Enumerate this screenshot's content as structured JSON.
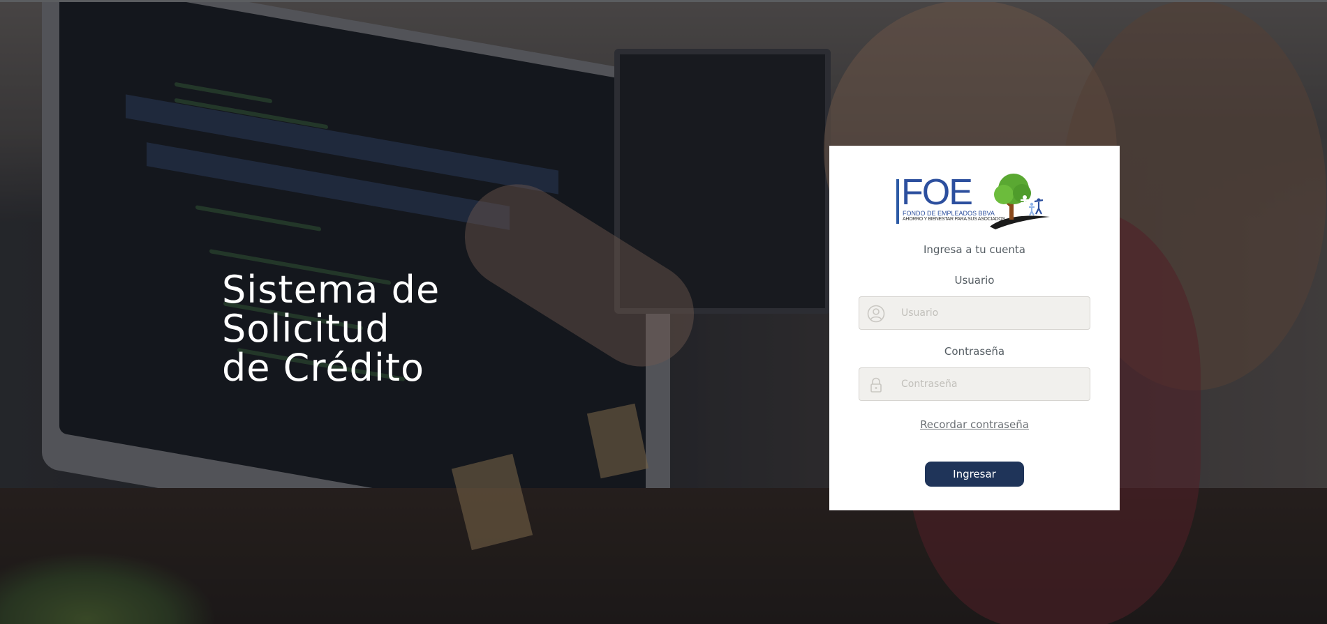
{
  "hero": {
    "line1": "Sistema de",
    "line2": "Solicitud",
    "line3": "de Crédito"
  },
  "logo": {
    "brand": "FOE",
    "tagline1": "FONDO DE EMPLEADOS BBVA",
    "tagline2": "AHORRO Y BIENESTAR PARA SUS ASOCIADOS"
  },
  "login": {
    "subtitle": "Ingresa a tu cuenta",
    "user_label": "Usuario",
    "user_placeholder": "Usuario",
    "user_value": "",
    "password_label": "Contraseña",
    "password_placeholder": "Contraseña",
    "password_value": "",
    "remember_link": "Recordar contraseña",
    "submit_label": "Ingresar"
  },
  "icons": {
    "user_field": "user-circle-icon",
    "password_field": "lock-icon"
  },
  "colors": {
    "button_bg": "#1f3459",
    "brand_blue": "#2c4f9e",
    "tree_green": "#5aa832",
    "field_bg": "#f1f0ed"
  }
}
